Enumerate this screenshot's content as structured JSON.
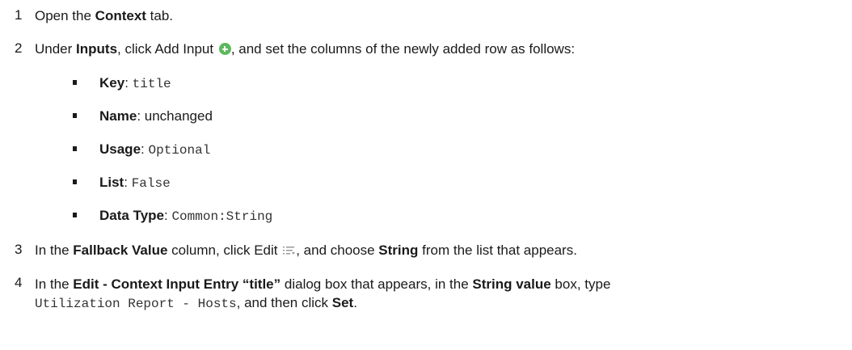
{
  "steps": [
    {
      "num": "1",
      "a": "Open the ",
      "b1": "Context",
      "c": " tab."
    },
    {
      "num": "2",
      "a": "Under ",
      "b1": "Inputs",
      "c": ", click Add Input ",
      "d": ", and set the columns of the newly added row as follows:"
    },
    {
      "num": "3",
      "a": "In the ",
      "b1": "Fallback Value",
      "c": " column, click Edit ",
      "d": ", and choose ",
      "b2": "String",
      "e": " from the list that appears."
    },
    {
      "num": "4",
      "a": "In the ",
      "b1": "Edit - Context Input Entry “title”",
      "c": " dialog box that appears, in the ",
      "b2": "String value",
      "d": " box, type",
      "code": "Utilization Report - Hosts",
      "e": ", and then click ",
      "b3": "Set",
      "f": "."
    }
  ],
  "bullets": [
    {
      "label": "Key",
      "sep": ": ",
      "value": "title",
      "mono": true
    },
    {
      "label": "Name",
      "sep": ": ",
      "value": "unchanged",
      "mono": false
    },
    {
      "label": "Usage",
      "sep": ": ",
      "value": "Optional",
      "mono": true
    },
    {
      "label": "List",
      "sep": ": ",
      "value": "False",
      "mono": true
    },
    {
      "label": "Data Type",
      "sep": ": ",
      "value": "Common:String",
      "mono": true
    }
  ],
  "icons": {
    "add": "add-input-icon",
    "edit": "edit-list-icon"
  },
  "colors": {
    "add_icon": "#5cb85c"
  }
}
